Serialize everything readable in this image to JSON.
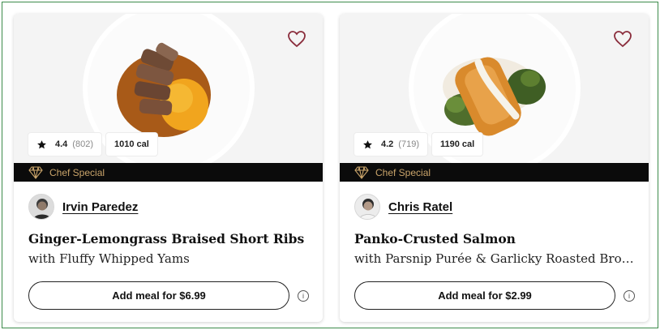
{
  "colors": {
    "accent_gold": "#c9a46a",
    "banner_bg": "#0b0b0b",
    "heart": "#8a2d3c",
    "frame": "#3c8a4a"
  },
  "meals": [
    {
      "rating": "4.4",
      "reviews": "(802)",
      "calories": "1010 cal",
      "badge": "Chef Special",
      "chef": "Irvin Paredez",
      "title": "Ginger-Lemongrass Braised Short Ribs",
      "subtitle": "with Fluffy Whipped Yams",
      "button": "Add meal for $6.99",
      "icons": {
        "favorite": "heart-outline-icon",
        "rating": "star-icon",
        "badge": "diamond-icon",
        "info": "info-icon"
      }
    },
    {
      "rating": "4.2",
      "reviews": "(719)",
      "calories": "1190 cal",
      "badge": "Chef Special",
      "chef": "Chris Ratel",
      "title": "Panko-Crusted Salmon",
      "subtitle": "with Parsnip Purée & Garlicky Roasted Broccoli",
      "button": "Add meal for $2.99",
      "icons": {
        "favorite": "heart-outline-icon",
        "rating": "star-icon",
        "badge": "diamond-icon",
        "info": "info-icon"
      }
    }
  ],
  "info_glyph": "i"
}
